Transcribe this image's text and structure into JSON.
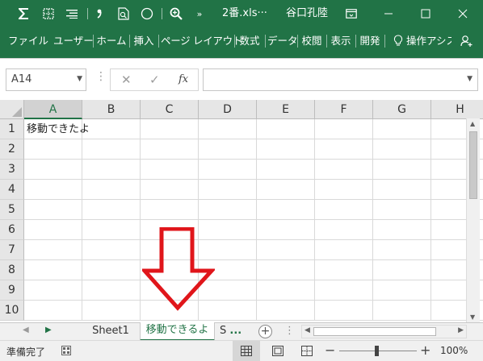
{
  "colors": {
    "brand": "#217346",
    "header_bg": "#e6e6e6",
    "arrow_red": "#e0161b"
  },
  "titlebar": {
    "qat_icons": [
      "autosum-icon",
      "table-grid-icon",
      "align-icon",
      "comma-style-icon",
      "print-preview-icon",
      "shape-circle-icon",
      "zoom-icon",
      "more-icon"
    ],
    "file_name": "2番.xls···",
    "user_name": "谷口孔陸",
    "window_icons": [
      "ribbon-display-icon",
      "minimize-icon",
      "maximize-icon",
      "close-icon"
    ]
  },
  "ribbon": {
    "tabs": [
      "ファイル",
      "ユーザー",
      "ホーム",
      "挿入",
      "ページ レイアウト",
      "数式",
      "データ",
      "校閲",
      "表示",
      "開発"
    ],
    "tell_me": "操作アシス",
    "share_icon": "share-person-icon"
  },
  "formula_bar": {
    "name_box": "A14",
    "cancel_symbol": "✕",
    "enter_symbol": "✓",
    "function_symbol": "fx",
    "formula_value": ""
  },
  "sheet": {
    "columns": [
      "A",
      "B",
      "C",
      "D",
      "E",
      "F",
      "G",
      "H"
    ],
    "selected_column": "A",
    "rows": [
      "1",
      "2",
      "3",
      "4",
      "5",
      "6",
      "7",
      "8",
      "9",
      "10"
    ],
    "cells": {
      "A1": "移動できたよ"
    }
  },
  "tabs": {
    "sheets": [
      "Sheet1",
      "移動できるよ",
      "S"
    ],
    "active_sheet": "移動できるよ",
    "overflow": "...",
    "add_symbol": "+",
    "scroll_dots": "⋮"
  },
  "status": {
    "text": "準備完了",
    "zoom_minus": "−",
    "zoom_plus": "+",
    "zoom": "100%",
    "zoom_percent": 100
  }
}
